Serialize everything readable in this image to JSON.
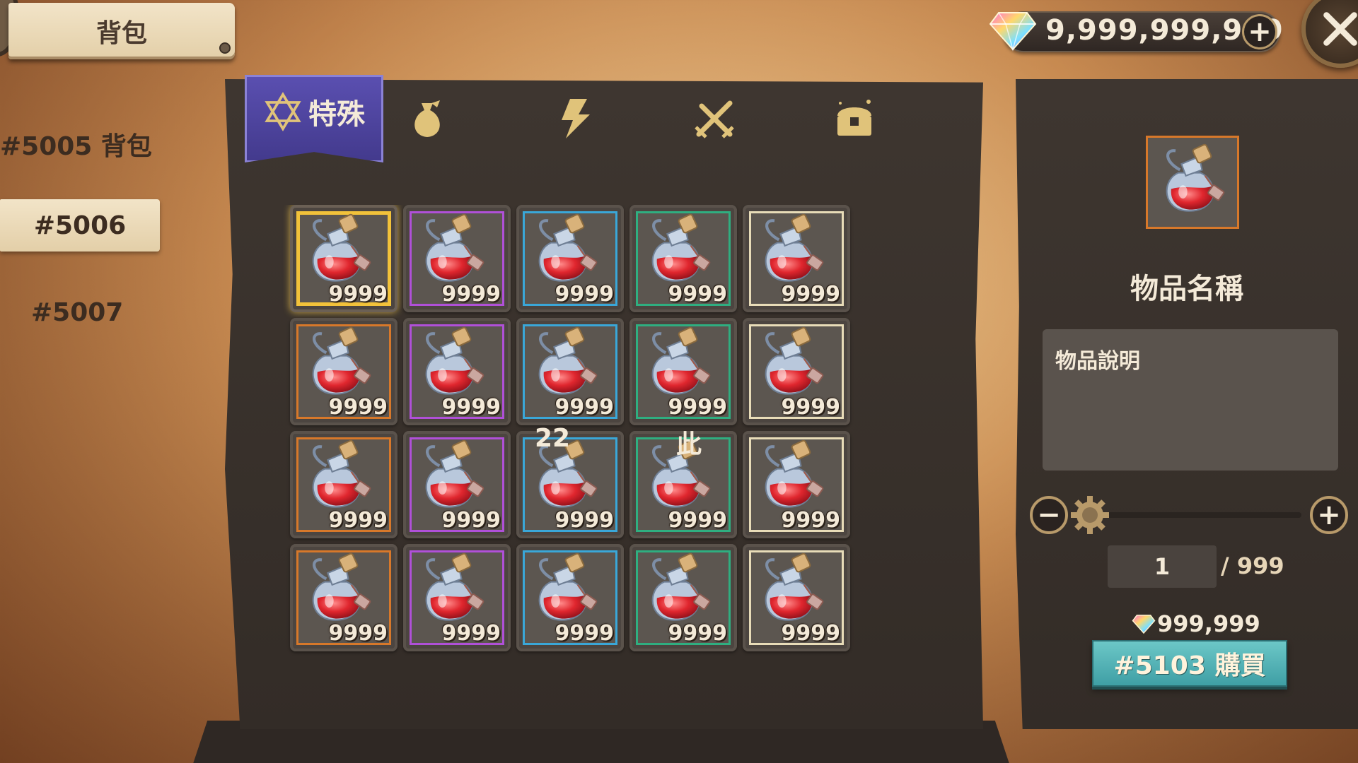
{
  "header": {
    "title": "背包",
    "currency_amount": "9,999,999,999",
    "currency_plus": "+"
  },
  "categories": [
    {
      "label": "#5005 背包",
      "selected": false
    },
    {
      "label": "#5006",
      "selected": true
    },
    {
      "label": "#5007",
      "selected": false
    }
  ],
  "tabs": {
    "active_label": "特殊",
    "icons": [
      "star-of-david-icon",
      "money-bag-icon",
      "lightning-icon",
      "crossed-swords-icon",
      "treasure-chest-icon"
    ]
  },
  "grid": {
    "frame_colors": [
      "#f2c23a",
      "#b050d8",
      "#3aa7d8",
      "#2fae80",
      "#e8dcb8",
      "#d7782a"
    ],
    "rows": [
      {
        "items": [
          {
            "qty": "9999",
            "rarity": "gold",
            "selected": true
          },
          {
            "qty": "9999",
            "rarity": "purple"
          },
          {
            "qty": "9999",
            "rarity": "blue"
          },
          {
            "qty": "9999",
            "rarity": "green"
          },
          {
            "qty": "9999",
            "rarity": "white"
          }
        ]
      },
      {
        "items": [
          {
            "qty": "9999",
            "rarity": "orange"
          },
          {
            "qty": "9999",
            "rarity": "purple"
          },
          {
            "qty": "9999",
            "rarity": "blue"
          },
          {
            "qty": "9999",
            "rarity": "green"
          },
          {
            "qty": "9999",
            "rarity": "white"
          }
        ]
      },
      {
        "items": [
          {
            "qty": "9999",
            "rarity": "orange"
          },
          {
            "qty": "9999",
            "rarity": "purple"
          },
          {
            "qty": "9999",
            "rarity": "blue"
          },
          {
            "qty": "9999",
            "rarity": "green"
          },
          {
            "qty": "9999",
            "rarity": "white"
          }
        ]
      },
      {
        "items": [
          {
            "qty": "9999",
            "rarity": "orange"
          },
          {
            "qty": "9999",
            "rarity": "purple"
          },
          {
            "qty": "9999",
            "rarity": "blue"
          },
          {
            "qty": "9999",
            "rarity": "green"
          },
          {
            "qty": "9999",
            "rarity": "white"
          }
        ]
      }
    ],
    "stray_texts": [
      "22",
      "此"
    ]
  },
  "detail": {
    "item_name": "物品名稱",
    "description": "物品說明",
    "minus": "−",
    "plus": "+",
    "quantity_value": "1",
    "quantity_max": "/ 999",
    "slider_fraction": 0.0,
    "price": "999,999",
    "buy_label": "#5103 購買"
  }
}
